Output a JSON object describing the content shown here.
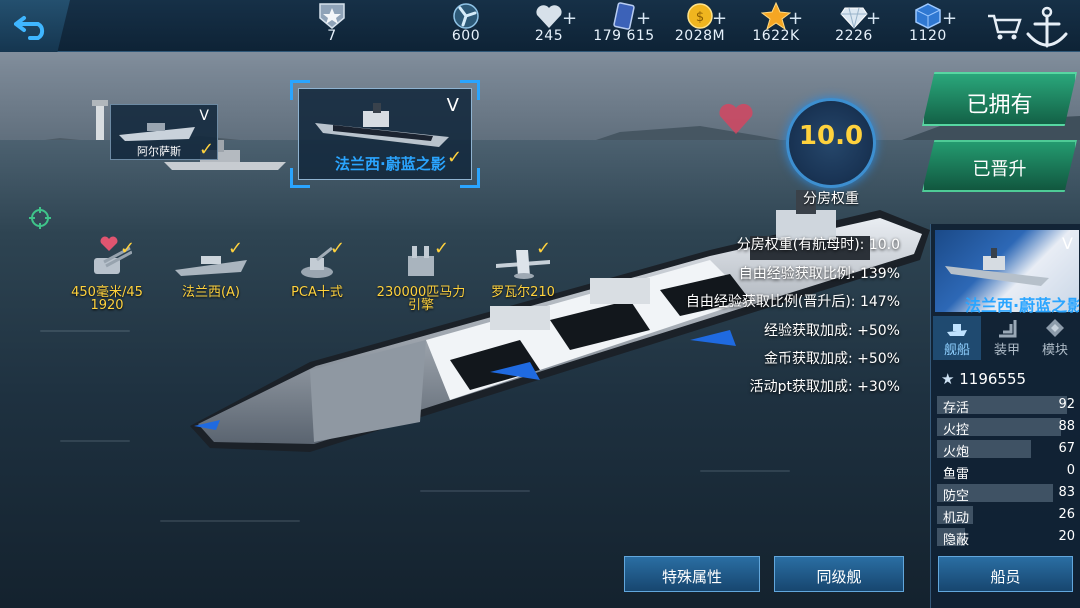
{
  "topbar": {
    "rank": "7",
    "resources": [
      {
        "id": "fuel",
        "value": "600",
        "icon": "propeller-icon",
        "has_plus": false
      },
      {
        "id": "hearts",
        "value": "245",
        "icon": "heart-icon",
        "has_plus": true
      },
      {
        "id": "cards",
        "value": "179 615",
        "icon": "card-icon",
        "has_plus": true
      },
      {
        "id": "gold",
        "value": "2028M",
        "icon": "gold-coin-icon",
        "has_plus": true
      },
      {
        "id": "stars",
        "value": "1622K",
        "icon": "star-icon",
        "has_plus": true
      },
      {
        "id": "diamonds",
        "value": "2226",
        "icon": "diamond-icon",
        "has_plus": true
      },
      {
        "id": "cubes",
        "value": "1120",
        "icon": "cube-icon",
        "has_plus": true
      }
    ]
  },
  "ships": {
    "secondary": {
      "name": "阿尔萨斯",
      "grade": "V"
    },
    "selected": {
      "name": "法兰西·蔚蓝之影",
      "grade": "V"
    }
  },
  "equipment": [
    {
      "line1": "450毫米/45",
      "line2": "1920",
      "icon": "gun-turret-icon"
    },
    {
      "line1": "法兰西(A)",
      "line2": "",
      "icon": "battleship-icon"
    },
    {
      "line1": "PCA十式",
      "line2": "",
      "icon": "aa-gun-icon"
    },
    {
      "line1": "230000匹马力",
      "line2": "引擎",
      "icon": "engine-icon"
    },
    {
      "line1": "罗瓦尔210",
      "line2": "",
      "icon": "seaplane-icon"
    }
  ],
  "rating": {
    "value": "10.0",
    "label": "分房权重"
  },
  "stats": [
    {
      "label": "分房权重(有航母时):",
      "value": "10.0"
    },
    {
      "label": "自由经验获取比例:",
      "value": "139%"
    },
    {
      "label": "自由经验获取比例(晋升后):",
      "value": "147%"
    },
    {
      "label": "经验获取加成:",
      "value": "+50%"
    },
    {
      "label": "金币获取加成:",
      "value": "+50%"
    },
    {
      "label": "活动pt获取加成:",
      "value": "+30%"
    }
  ],
  "buttons": {
    "owned": "已拥有",
    "upgraded": "已晋升",
    "special": "特殊属性",
    "same_class": "同级舰",
    "crew": "船员"
  },
  "panel": {
    "ship_name": "法兰西·蔚蓝之影",
    "grade": "V",
    "tabs": [
      "舰船",
      "装甲",
      "模块"
    ],
    "power": "1196555",
    "attributes": [
      {
        "label": "存活",
        "value": "92"
      },
      {
        "label": "火控",
        "value": "88"
      },
      {
        "label": "火炮",
        "value": "67"
      },
      {
        "label": "鱼雷",
        "value": "0"
      },
      {
        "label": "防空",
        "value": "83"
      },
      {
        "label": "机动",
        "value": "26"
      },
      {
        "label": "隐蔽",
        "value": "20"
      }
    ]
  },
  "colors": {
    "accent_yellow": "#ffd23d",
    "accent_blue": "#2aa5ff",
    "owned_green": "#2aa77b"
  }
}
